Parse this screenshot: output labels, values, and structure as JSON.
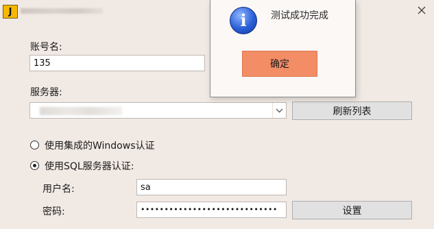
{
  "window": {
    "app_icon_glyph": "J",
    "close_glyph": "✕"
  },
  "form": {
    "account_label": "账号名:",
    "account_value": "135",
    "server_label": "服务器:",
    "refresh_button": "刷新列表",
    "auth_windows_label": "使用集成的Windows认证",
    "auth_sql_label": "使用SQL服务器认证:",
    "auth_selected": "sql",
    "username_label": "用户名:",
    "username_value": "sa",
    "password_label": "密码:",
    "password_value": "•••••••••••••••••••••••••••••",
    "settings_button": "设置"
  },
  "message_box": {
    "icon": "information-icon",
    "message": "测试成功完成",
    "ok_button": "确定"
  },
  "colors": {
    "background": "#f1e9e4",
    "ok_button": "#f28d66",
    "info_icon": "#2a5fd8"
  }
}
